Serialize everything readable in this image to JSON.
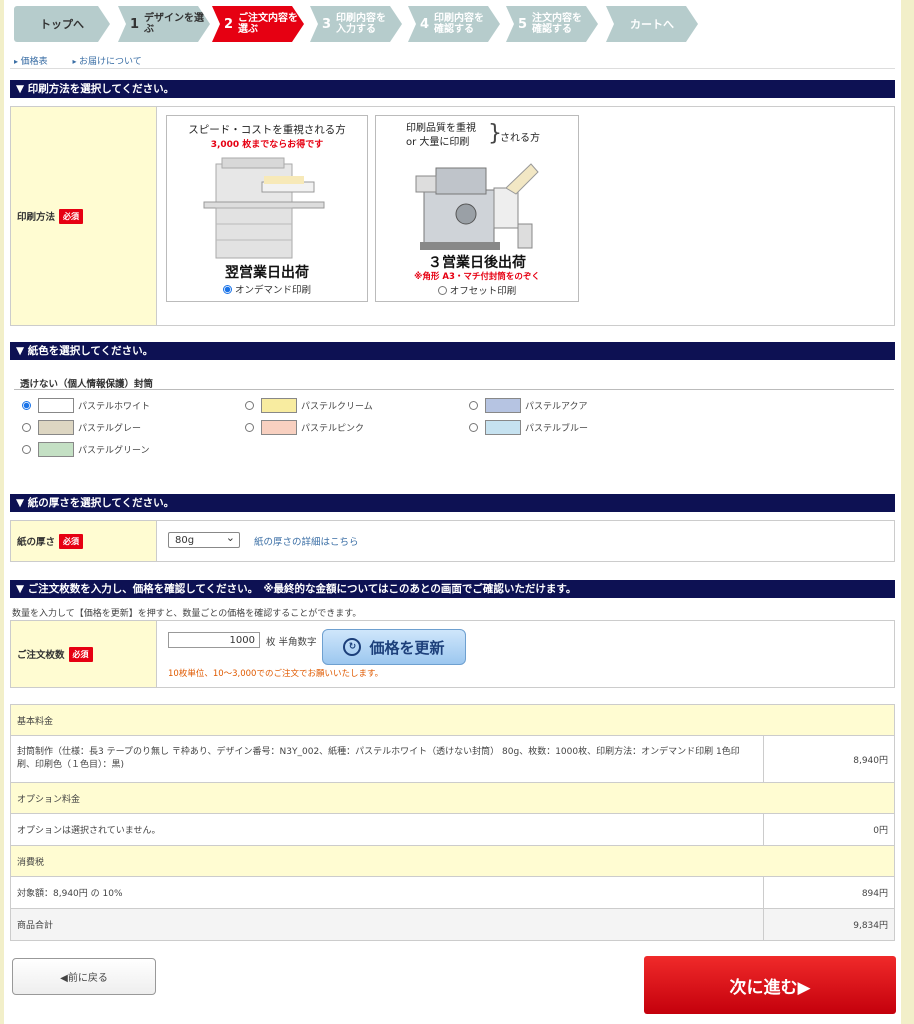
{
  "steps": [
    {
      "num": "",
      "label": "トップへ"
    },
    {
      "num": "1",
      "label": "デザインを選ぶ"
    },
    {
      "num": "2",
      "label": "ご注文内容を\n選ぶ"
    },
    {
      "num": "3",
      "label": "印刷内容を\n入力する"
    },
    {
      "num": "4",
      "label": "印刷内容を\n確認する"
    },
    {
      "num": "5",
      "label": "注文内容を\n確認する"
    },
    {
      "num": "",
      "label": "カートへ"
    }
  ],
  "sublinks": [
    "価格表",
    "お届けについて"
  ],
  "print_method": {
    "heading": "▼ 印刷方法を選択してください。",
    "label": "印刷方法",
    "required": "必須",
    "ondemand": {
      "line1": "スピード・コストを重視される方",
      "line2": "3,000 枚までならお得です",
      "ship": "翌営業日出荷",
      "option": "オンデマンド印刷"
    },
    "offset": {
      "line1a": "印刷品質を重視",
      "line1b": "or 大量に印刷",
      "line1c": "される方",
      "ship": "３営業日後出荷",
      "note": "※角形 A3・マチ付封筒をのぞく",
      "option": "オフセット印刷"
    }
  },
  "paper_color": {
    "heading": "▼ 紙色を選択してください。",
    "group": "透けない（個人情報保護）封筒",
    "options": [
      {
        "label": "パステルホワイト",
        "color": "#ffffff",
        "selected": true
      },
      {
        "label": "パステルクリーム",
        "color": "#f8eca0",
        "selected": false
      },
      {
        "label": "パステルアクア",
        "color": "#b6c4e2",
        "selected": false
      },
      {
        "label": "パステルグレー",
        "color": "#ddd6c2",
        "selected": false
      },
      {
        "label": "パステルピンク",
        "color": "#f8d0c0",
        "selected": false
      },
      {
        "label": "パステルブルー",
        "color": "#c6e2f0",
        "selected": false
      },
      {
        "label": "パステルグリーン",
        "color": "#c4e0c4",
        "selected": false
      }
    ]
  },
  "thickness": {
    "heading": "▼ 紙の厚さを選択してください。",
    "label": "紙の厚さ",
    "required": "必須",
    "value": "80g",
    "link": "紙の厚さの詳細はこちら"
  },
  "quantity": {
    "heading": "▼ ご注文枚数を入力し、価格を確認してください。　※最終的な金額についてはこのあとの画面でご確認いただけます。",
    "intro": "数量を入力して【価格を更新】を押すと、数量ごとの価格を確認することができます。",
    "label": "ご注文枚数",
    "required": "必須",
    "value": "1000",
    "unit": "枚 半角数字",
    "button": "価格を更新",
    "note": "10枚単位、10～3,000でのご注文でお願いいたします。"
  },
  "price_table": {
    "base_header": "基本料金",
    "base_desc": "封筒制作（仕様：長3 テープのり無し 〒枠あり、デザイン番号：N3Y_002、紙種：パステルホワイト（透けない封筒） 80g、枚数：1000枚、印刷方法：オンデマンド印刷 1色印刷、印刷色（１色目）：黒)",
    "base_amount": "8,940円",
    "option_header": "オプション料金",
    "option_desc": "オプションは選択されていません。",
    "option_amount": "0円",
    "tax_header": "消費税",
    "tax_desc": "対象額：8,940円 の 10%",
    "tax_amount": "894円",
    "total_label": "商品合計",
    "total_amount": "9,834円"
  },
  "nav": {
    "back": "◀前に戻る",
    "next": "次に進む▶"
  }
}
